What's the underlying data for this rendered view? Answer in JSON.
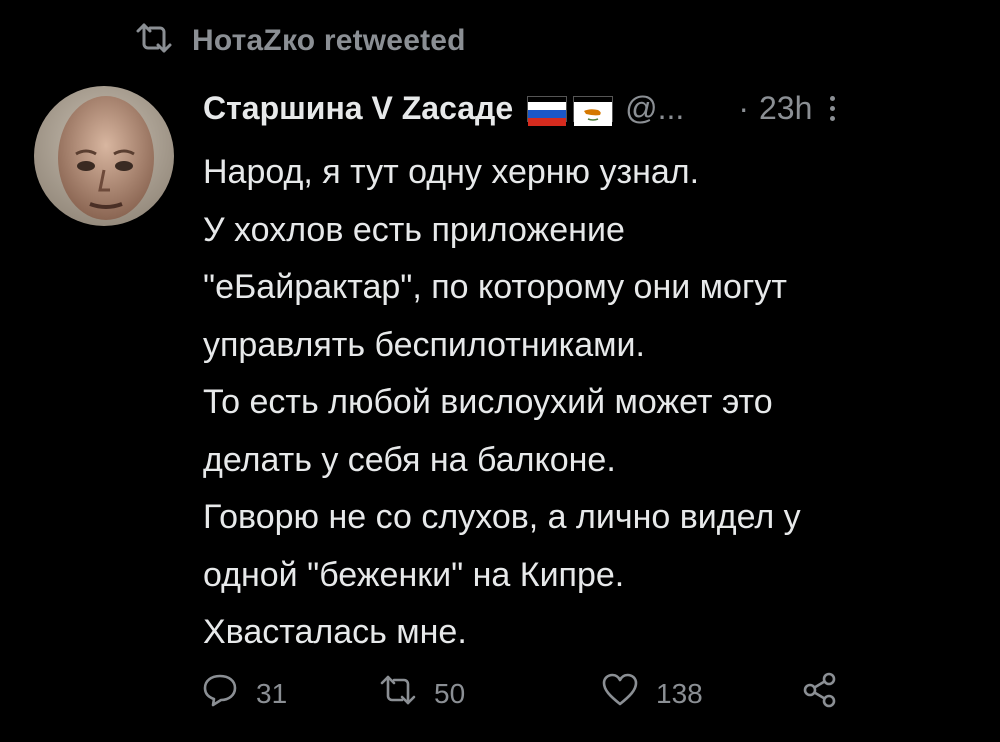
{
  "retweet": {
    "text": "НотаZко retweeted",
    "icon": "retweet-icon"
  },
  "tweet": {
    "author": {
      "display_name": "Старшина V Zасаде",
      "handle": "@...",
      "flags": [
        "russia-flag",
        "cyprus-flag"
      ]
    },
    "dot": "·",
    "time": "23h",
    "lines": [
      "Народ, я тут одну херню узнал.",
      "У хохлов есть приложение",
      "\"еБайрактар\", по которому они могут",
      "управлять беспилотниками.",
      "То есть любой вислоухий может это",
      "делать у себя на балконе.",
      "Говорю не со слухов, а лично видел у",
      "одной \"беженки\" на Кипре.",
      "Хвасталась мне."
    ],
    "actions": {
      "replies": "31",
      "retweets": "50",
      "likes": "138"
    }
  },
  "colors": {
    "background": "#000000",
    "text": "#e7e9ea",
    "muted": "#8b8f94"
  }
}
